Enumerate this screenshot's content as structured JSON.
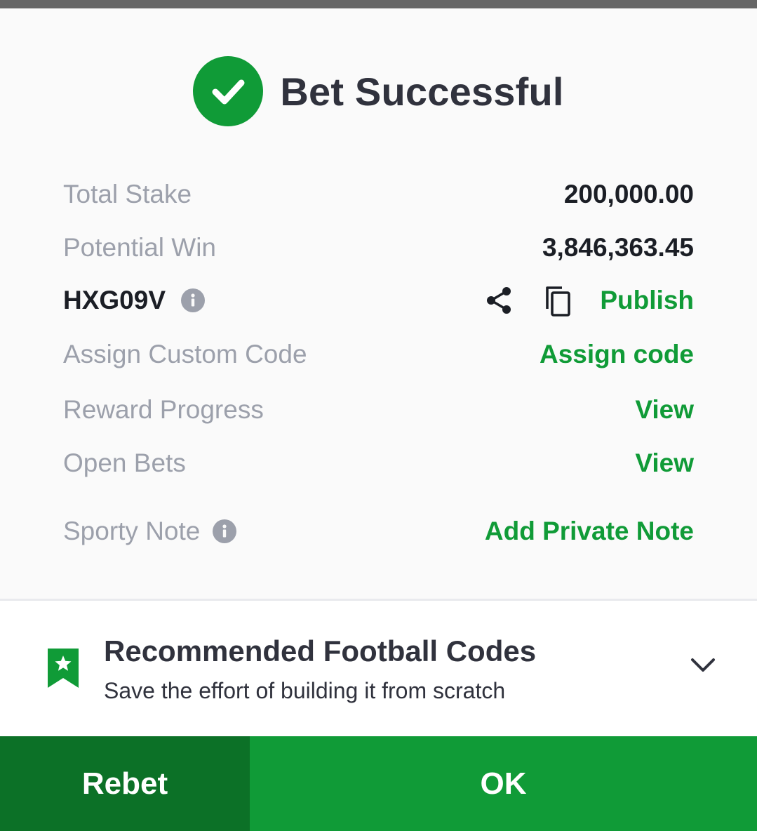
{
  "header": {
    "title": "Bet Successful"
  },
  "details": {
    "total_stake_label": "Total Stake",
    "total_stake_value": "200,000.00",
    "potential_win_label": "Potential Win",
    "potential_win_value": "3,846,363.45",
    "booking_code": "HXG09V",
    "publish_label": "Publish",
    "assign_label": "Assign Custom Code",
    "assign_link": "Assign code",
    "reward_label": "Reward Progress",
    "reward_link": "View",
    "open_bets_label": "Open Bets",
    "open_bets_link": "View",
    "note_label": "Sporty Note",
    "note_link": "Add Private Note"
  },
  "recommended": {
    "title": "Recommended Football Codes",
    "subtitle": "Save the effort of building it from scratch"
  },
  "footer": {
    "rebet_label": "Rebet",
    "ok_label": "OK"
  },
  "colors": {
    "accent_green": "#109b37",
    "dark_green": "#0c7127",
    "label_gray": "#9ca0ab",
    "text_dark": "#1b1e25"
  },
  "icons": [
    "check-icon",
    "info-icon",
    "share-icon",
    "copy-icon",
    "bookmark-star-icon",
    "chevron-down-icon"
  ]
}
